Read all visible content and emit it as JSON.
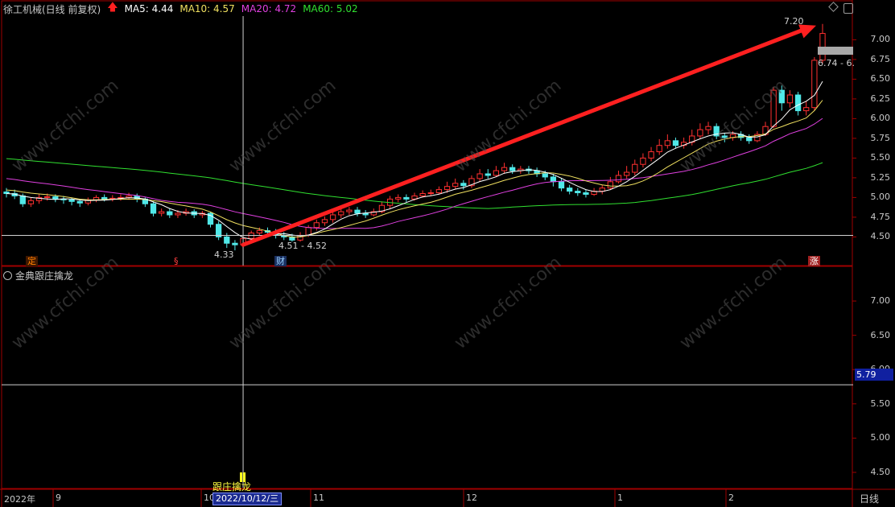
{
  "header": {
    "title": "徐工机械(日线 前复权)",
    "ma5": "MA5: 4.44",
    "ma10": "MA10: 4.57",
    "ma20": "MA20: 4.72",
    "ma60": "MA60: 5.02"
  },
  "indicator": {
    "title": "金典跟庄擒龙",
    "signal_label": "跟庄擒龙"
  },
  "price_axis": [
    "7.00",
    "6.75",
    "6.50",
    "6.25",
    "6.00",
    "5.75",
    "5.50",
    "5.25",
    "5.00",
    "4.75",
    "4.50"
  ],
  "indicator_axis": [
    "7.00",
    "6.50",
    "6.00",
    "5.50",
    "5.00",
    "4.50"
  ],
  "current_value": "5.79",
  "labels": {
    "high": "7.20",
    "range_hi": "6.74 - 6.",
    "low": "4.33",
    "range_low": "4.51 - 4.52",
    "mark_ding": "定",
    "mark_s": "§",
    "mark_cai": "财",
    "mark_zhang": "涨"
  },
  "x_axis": {
    "ticks": [
      "2022年",
      "9",
      "10",
      "11",
      "12",
      "1",
      "2"
    ],
    "cursor_date": "2022/10/12/三",
    "period": "日线"
  },
  "watermark": "www.cfchi.com",
  "colors": {
    "up": "#ff3030",
    "down": "#50e8e8",
    "ma5": "#ffffff",
    "ma10": "#f0e060",
    "ma20": "#e040e0",
    "ma60": "#30e030",
    "arrow": "#ff2020"
  },
  "chart_data": {
    "type": "candlestick",
    "ylim": [
      4.3,
      7.3
    ],
    "candles": [
      [
        5.07,
        5.05,
        5.12,
        5.0
      ],
      [
        5.05,
        5.02,
        5.1,
        4.98
      ],
      [
        5.02,
        4.92,
        5.05,
        4.88
      ],
      [
        4.92,
        4.96,
        5.0,
        4.88
      ],
      [
        4.96,
        5.0,
        5.04,
        4.92
      ],
      [
        5.0,
        5.01,
        5.05,
        4.96
      ],
      [
        5.01,
        4.98,
        5.04,
        4.94
      ],
      [
        4.98,
        4.97,
        5.02,
        4.92
      ],
      [
        4.97,
        4.95,
        5.0,
        4.9
      ],
      [
        4.95,
        4.93,
        4.98,
        4.88
      ],
      [
        4.93,
        4.97,
        5.0,
        4.9
      ],
      [
        4.97,
        5.0,
        5.03,
        4.94
      ],
      [
        5.0,
        4.98,
        5.04,
        4.95
      ],
      [
        4.98,
        4.99,
        5.03,
        4.95
      ],
      [
        4.99,
        5.0,
        5.04,
        4.96
      ],
      [
        5.0,
        5.02,
        5.06,
        4.97
      ],
      [
        5.02,
        4.98,
        5.05,
        4.94
      ],
      [
        4.98,
        4.92,
        5.0,
        4.88
      ],
      [
        4.92,
        4.8,
        4.95,
        4.76
      ],
      [
        4.8,
        4.82,
        4.86,
        4.76
      ],
      [
        4.82,
        4.78,
        4.86,
        4.74
      ],
      [
        4.78,
        4.8,
        4.84,
        4.74
      ],
      [
        4.8,
        4.82,
        4.86,
        4.77
      ],
      [
        4.82,
        4.78,
        4.85,
        4.74
      ],
      [
        4.78,
        4.8,
        4.83,
        4.74
      ],
      [
        4.8,
        4.66,
        4.82,
        4.62
      ],
      [
        4.66,
        4.5,
        4.7,
        4.46
      ],
      [
        4.5,
        4.42,
        4.55,
        4.36
      ],
      [
        4.42,
        4.4,
        4.46,
        4.33
      ],
      [
        4.4,
        4.48,
        4.52,
        4.36
      ],
      [
        4.48,
        4.55,
        4.58,
        4.45
      ],
      [
        4.55,
        4.58,
        4.62,
        4.52
      ],
      [
        4.58,
        4.56,
        4.62,
        4.52
      ],
      [
        4.56,
        4.52,
        4.6,
        4.48
      ],
      [
        4.52,
        4.5,
        4.56,
        4.46
      ],
      [
        4.5,
        4.46,
        4.54,
        4.44
      ],
      [
        4.46,
        4.52,
        4.56,
        4.44
      ],
      [
        4.52,
        4.62,
        4.65,
        4.5
      ],
      [
        4.62,
        4.68,
        4.72,
        4.58
      ],
      [
        4.68,
        4.72,
        4.76,
        4.64
      ],
      [
        4.72,
        4.78,
        4.82,
        4.68
      ],
      [
        4.78,
        4.82,
        4.86,
        4.74
      ],
      [
        4.82,
        4.84,
        4.88,
        4.78
      ],
      [
        4.84,
        4.8,
        4.88,
        4.76
      ],
      [
        4.8,
        4.78,
        4.84,
        4.74
      ],
      [
        4.78,
        4.82,
        4.86,
        4.76
      ],
      [
        4.82,
        4.9,
        4.95,
        4.8
      ],
      [
        4.9,
        4.98,
        5.02,
        4.86
      ],
      [
        4.98,
        5.0,
        5.04,
        4.94
      ],
      [
        5.0,
        4.98,
        5.04,
        4.94
      ],
      [
        4.98,
        5.02,
        5.06,
        4.96
      ],
      [
        5.02,
        5.05,
        5.09,
        5.0
      ],
      [
        5.05,
        5.06,
        5.1,
        5.02
      ],
      [
        5.06,
        5.1,
        5.14,
        5.04
      ],
      [
        5.1,
        5.14,
        5.2,
        5.06
      ],
      [
        5.14,
        5.18,
        5.24,
        5.1
      ],
      [
        5.18,
        5.15,
        5.22,
        5.1
      ],
      [
        5.15,
        5.24,
        5.28,
        5.12
      ],
      [
        5.24,
        5.3,
        5.36,
        5.2
      ],
      [
        5.3,
        5.28,
        5.36,
        5.24
      ],
      [
        5.28,
        5.34,
        5.4,
        5.26
      ],
      [
        5.34,
        5.38,
        5.44,
        5.3
      ],
      [
        5.38,
        5.34,
        5.42,
        5.3
      ],
      [
        5.34,
        5.36,
        5.4,
        5.3
      ],
      [
        5.36,
        5.34,
        5.4,
        5.3
      ],
      [
        5.34,
        5.3,
        5.38,
        5.26
      ],
      [
        5.3,
        5.26,
        5.34,
        5.22
      ],
      [
        5.26,
        5.2,
        5.3,
        5.14
      ],
      [
        5.2,
        5.12,
        5.24,
        5.08
      ],
      [
        5.12,
        5.08,
        5.16,
        5.04
      ],
      [
        5.08,
        5.06,
        5.12,
        5.02
      ],
      [
        5.06,
        5.04,
        5.1,
        5.0
      ],
      [
        5.04,
        5.08,
        5.12,
        5.02
      ],
      [
        5.08,
        5.12,
        5.16,
        5.04
      ],
      [
        5.12,
        5.2,
        5.26,
        5.1
      ],
      [
        5.2,
        5.28,
        5.34,
        5.18
      ],
      [
        5.28,
        5.32,
        5.4,
        5.24
      ],
      [
        5.32,
        5.42,
        5.48,
        5.28
      ],
      [
        5.42,
        5.5,
        5.56,
        5.38
      ],
      [
        5.5,
        5.58,
        5.64,
        5.46
      ],
      [
        5.58,
        5.66,
        5.74,
        5.54
      ],
      [
        5.66,
        5.72,
        5.8,
        5.62
      ],
      [
        5.72,
        5.66,
        5.76,
        5.62
      ],
      [
        5.66,
        5.7,
        5.76,
        5.62
      ],
      [
        5.7,
        5.78,
        5.86,
        5.66
      ],
      [
        5.78,
        5.86,
        5.94,
        5.74
      ],
      [
        5.86,
        5.9,
        5.96,
        5.8
      ],
      [
        5.9,
        5.78,
        5.94,
        5.74
      ],
      [
        5.78,
        5.76,
        5.82,
        5.7
      ],
      [
        5.76,
        5.8,
        5.84,
        5.72
      ],
      [
        5.8,
        5.76,
        5.84,
        5.72
      ],
      [
        5.76,
        5.72,
        5.8,
        5.68
      ],
      [
        5.72,
        5.8,
        5.84,
        5.7
      ],
      [
        5.8,
        5.9,
        5.96,
        5.78
      ],
      [
        5.9,
        6.36,
        6.4,
        5.88
      ],
      [
        6.36,
        6.2,
        6.42,
        6.1
      ],
      [
        6.2,
        6.3,
        6.36,
        6.14
      ],
      [
        6.3,
        6.1,
        6.34,
        6.04
      ],
      [
        6.1,
        6.14,
        6.22,
        6.04
      ],
      [
        6.14,
        6.74,
        6.78,
        6.1
      ],
      [
        6.74,
        7.08,
        7.2,
        6.7
      ]
    ]
  }
}
